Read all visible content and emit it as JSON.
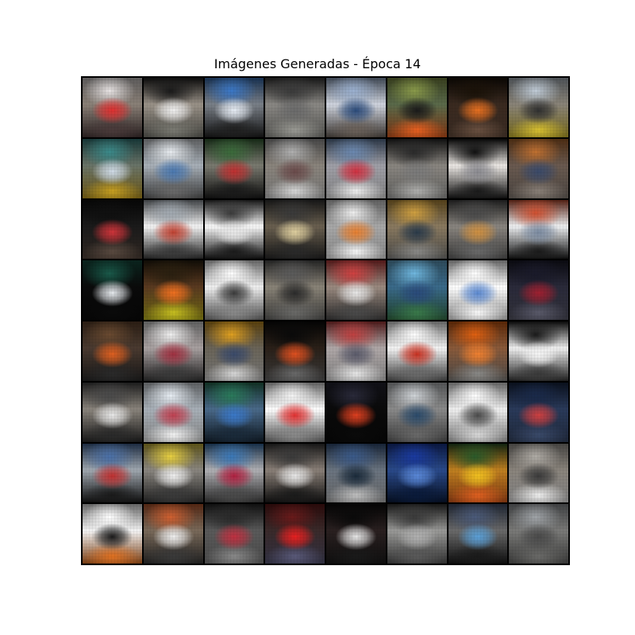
{
  "figure": {
    "title": "Imágenes Generadas - Época 14"
  },
  "grid": {
    "rows": 8,
    "cols": 8,
    "tiles": [
      {
        "bg": "#8a8077",
        "top": "#e8e4e4",
        "mid": "#e03030",
        "bot": "#4a3a3a"
      },
      {
        "bg": "#9a9288",
        "top": "#1a1a1a",
        "mid": "#f0f0f0",
        "bot": "#7a7a72"
      },
      {
        "bg": "#7a8088",
        "top": "#3a78c8",
        "mid": "#e8eef6",
        "bot": "#202020"
      },
      {
        "bg": "#8a8884",
        "top": "#3a3a3a",
        "mid": "#6a6a6a",
        "bot": "#9a9a94"
      },
      {
        "bg": "#cfd4de",
        "top": "#9ab0d0",
        "mid": "#2a4a7a",
        "bot": "#6a6058"
      },
      {
        "bg": "#5a6a4a",
        "top": "#8a9a4a",
        "mid": "#1a1a1a",
        "bot": "#e86020"
      },
      {
        "bg": "#3a2a20",
        "top": "#1a1208",
        "mid": "#e87020",
        "bot": "#6a5040"
      },
      {
        "bg": "#8a8478",
        "top": "#c0ccd8",
        "mid": "#303030",
        "bot": "#d8c030"
      },
      {
        "bg": "#6a7468",
        "top": "#3a8a8a",
        "mid": "#d0dce8",
        "bot": "#c8a020"
      },
      {
        "bg": "#a8b0b8",
        "top": "#e8ecf0",
        "mid": "#4a78b0",
        "bot": "#6a6a6a"
      },
      {
        "bg": "#7a7a70",
        "top": "#3a6a3a",
        "mid": "#c03030",
        "bot": "#1a1a1a"
      },
      {
        "bg": "#8a847c",
        "top": "#b0b0b0",
        "mid": "#6a4a4a",
        "bot": "#d8d8d8"
      },
      {
        "bg": "#a0a0a8",
        "top": "#6a88b0",
        "mid": "#d03040",
        "bot": "#f0f0f0"
      },
      {
        "bg": "#8a8680",
        "top": "#2a2a2a",
        "mid": "#7a7a7a",
        "bot": "#b0b0ae"
      },
      {
        "bg": "#ece8e4",
        "top": "#101010",
        "mid": "#8a8a90",
        "bot": "#1a1a1a"
      },
      {
        "bg": "#6a5a50",
        "top": "#c07030",
        "mid": "#3a4a6a",
        "bot": "#8a8078"
      },
      {
        "bg": "#1a1a1a",
        "top": "#101010",
        "mid": "#d0343a",
        "bot": "#5a4a40"
      },
      {
        "bg": "#f4f4f4",
        "top": "#a0a8b0",
        "mid": "#c04030",
        "bot": "#3a3a3a"
      },
      {
        "bg": "#fafafa",
        "top": "#3a3a3a",
        "mid": "#e8e8e8",
        "bot": "#1a1a1a"
      },
      {
        "bg": "#6a6050",
        "top": "#3a3a3a",
        "mid": "#e0d0a0",
        "bot": "#2a2a2a"
      },
      {
        "bg": "#a8a8a8",
        "top": "#f0f0f0",
        "mid": "#e88030",
        "bot": "#f8f8f8"
      },
      {
        "bg": "#8a7a60",
        "top": "#d0a040",
        "mid": "#2a3a4a",
        "bot": "#8a8a88"
      },
      {
        "bg": "#8a8680",
        "top": "#4a4a4a",
        "mid": "#d09040",
        "bot": "#6a6a6a"
      },
      {
        "bg": "#eef0f2",
        "top": "#d05030",
        "mid": "#7a8aa0",
        "bot": "#1a1a1a"
      },
      {
        "bg": "#0a0a0a",
        "top": "#1a5a4a",
        "mid": "#e8ecf0",
        "bot": "#0a0a0a"
      },
      {
        "bg": "#5a3a20",
        "top": "#2a2010",
        "mid": "#f07020",
        "bot": "#c8c020"
      },
      {
        "bg": "#f0f0f0",
        "top": "#ffffff",
        "mid": "#3a3a3a",
        "bot": "#8a8a8a"
      },
      {
        "bg": "#8a8478",
        "top": "#5a5a5a",
        "mid": "#2a2a2a",
        "bot": "#6a6a68"
      },
      {
        "bg": "#9a8a80",
        "top": "#d04040",
        "mid": "#e8e8e8",
        "bot": "#4a4a4a"
      },
      {
        "bg": "#3a6a8a",
        "top": "#70b8e0",
        "mid": "#2a4a7a",
        "bot": "#3a7a4a"
      },
      {
        "bg": "#ffffff",
        "top": "#ffffff",
        "mid": "#5a88d0",
        "bot": "#fafafa"
      },
      {
        "bg": "#2a2a3a",
        "top": "#1a1a2a",
        "mid": "#a02030",
        "bot": "#5a5a6a"
      },
      {
        "bg": "#4a3a30",
        "top": "#6a4a30",
        "mid": "#e06020",
        "bot": "#2a2a2a"
      },
      {
        "bg": "#a8a0a0",
        "top": "#f0f0f0",
        "mid": "#a03040",
        "bot": "#3a3a3a"
      },
      {
        "bg": "#6a6458",
        "top": "#e0a020",
        "mid": "#3a4a6a",
        "bot": "#d8d8d8"
      },
      {
        "bg": "#2a2018",
        "top": "#0a0a0a",
        "mid": "#e05020",
        "bot": "#6a6a6a"
      },
      {
        "bg": "#b0a8a8",
        "top": "#c04040",
        "mid": "#5a5a6a",
        "bot": "#e8e8e8"
      },
      {
        "bg": "#f4f4f4",
        "top": "#ffffff",
        "mid": "#c83020",
        "bot": "#6a6a6a"
      },
      {
        "bg": "#8a5a3a",
        "top": "#e06010",
        "mid": "#f08030",
        "bot": "#8a8a88"
      },
      {
        "bg": "#f0f0f0",
        "top": "#1a1a1a",
        "mid": "#f4f4f4",
        "bot": "#3a3a3a"
      },
      {
        "bg": "#8a847c",
        "top": "#4a4a4a",
        "mid": "#e8e8e8",
        "bot": "#2a2a2a"
      },
      {
        "bg": "#a8b0b8",
        "top": "#e8eef4",
        "mid": "#c04050",
        "bot": "#f4f4f4"
      },
      {
        "bg": "#4a6a8a",
        "top": "#2a7a5a",
        "mid": "#3a78c8",
        "bot": "#1a2a3a"
      },
      {
        "bg": "#ffffff",
        "top": "#f4f4f4",
        "mid": "#e03030",
        "bot": "#8a8a8a"
      },
      {
        "bg": "#0a0a0a",
        "top": "#2a2a3a",
        "mid": "#e04020",
        "bot": "#0a0a0a"
      },
      {
        "bg": "#8a8a8a",
        "top": "#d0d4d8",
        "mid": "#2a4a6a",
        "bot": "#6a6a6a"
      },
      {
        "bg": "#f0f0f0",
        "top": "#ffffff",
        "mid": "#4a4a4a",
        "bot": "#d8d8d8"
      },
      {
        "bg": "#2a3a5a",
        "top": "#1a2a4a",
        "mid": "#d04040",
        "bot": "#3a4a6a"
      },
      {
        "bg": "#a0a8b0",
        "top": "#4a70a8",
        "mid": "#c03030",
        "bot": "#1a1a1a"
      },
      {
        "bg": "#8a8680",
        "top": "#e8d040",
        "mid": "#f0f0f0",
        "bot": "#3a3a3a"
      },
      {
        "bg": "#b0b0b4",
        "top": "#3a78b8",
        "mid": "#b02040",
        "bot": "#4a4a4a"
      },
      {
        "bg": "#8a8078",
        "top": "#3a3a3a",
        "mid": "#e8e8e8",
        "bot": "#1a1a1a"
      },
      {
        "bg": "#6a7480",
        "top": "#3a5a8a",
        "mid": "#1a2a3a",
        "bot": "#c0c0c0"
      },
      {
        "bg": "#2a4a8a",
        "top": "#1a3aa0",
        "mid": "#5a88d8",
        "bot": "#0a1a3a"
      },
      {
        "bg": "#c08020",
        "top": "#2a5a2a",
        "mid": "#f0c020",
        "bot": "#e06020"
      },
      {
        "bg": "#8a847c",
        "top": "#b0aca6",
        "mid": "#3a3a3a",
        "bot": "#f0f0f0"
      },
      {
        "bg": "#f4f4f4",
        "top": "#ffffff",
        "mid": "#1a1a1a",
        "bot": "#e07020"
      },
      {
        "bg": "#7a6a5a",
        "top": "#d06030",
        "mid": "#f0f0f0",
        "bot": "#3a3a3a"
      },
      {
        "bg": "#5a5a5a",
        "top": "#2a2a2a",
        "mid": "#c03040",
        "bot": "#8a8a8a"
      },
      {
        "bg": "#3a2a2a",
        "top": "#6a1a1a",
        "mid": "#e82020",
        "bot": "#5a5a7a"
      },
      {
        "bg": "#2a2020",
        "top": "#0a0a0a",
        "mid": "#e8e8e8",
        "bot": "#1a1a1a"
      },
      {
        "bg": "#9a9a98",
        "top": "#3a3a3a",
        "mid": "#b0b0b0",
        "bot": "#5a5a5a"
      },
      {
        "bg": "#6a6a6a",
        "top": "#4a5a7a",
        "mid": "#5aa0d8",
        "bot": "#1a1a1a"
      },
      {
        "bg": "#7a7a78",
        "top": "#a0a4a8",
        "mid": "#4a4a4a",
        "bot": "#6a6a68"
      }
    ]
  }
}
